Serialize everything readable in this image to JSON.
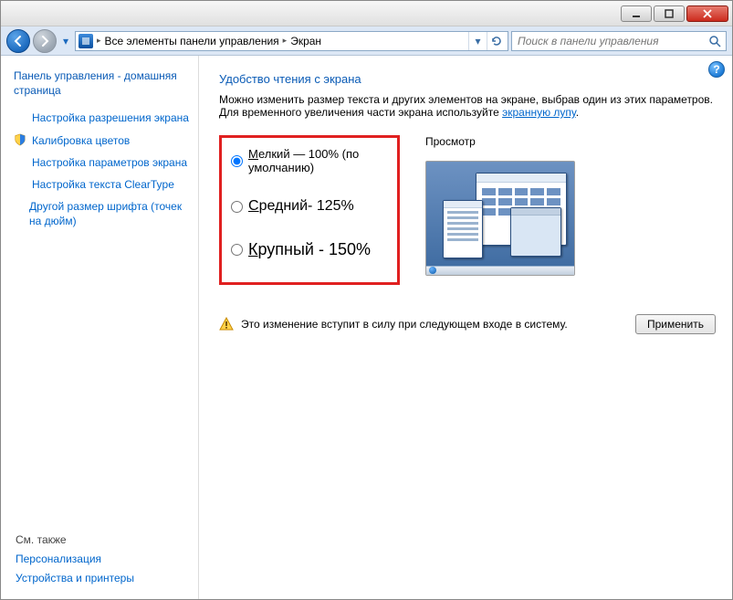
{
  "titlebar": {},
  "nav": {
    "breadcrumb": {
      "parent": "Все элементы панели управления",
      "current": "Экран"
    },
    "search_placeholder": "Поиск в панели управления"
  },
  "sidebar": {
    "home": "Панель управления - домашняя страница",
    "links": [
      {
        "label": "Настройка разрешения экрана"
      },
      {
        "label": "Калибровка цветов",
        "shield": true
      },
      {
        "label": "Настройка параметров экрана"
      },
      {
        "label": "Настройка текста ClearType"
      },
      {
        "label": "Другой размер шрифта (точек на дюйм)"
      }
    ],
    "see_also_label": "См. также",
    "see_also": [
      "Персонализация",
      "Устройства и принтеры"
    ]
  },
  "main": {
    "heading": "Удобство чтения с экрана",
    "desc_prefix": "Можно изменить размер текста и других элементов на экране, выбрав один из этих параметров. Для временного увеличения части экрана используйте ",
    "desc_link": "экранную лупу",
    "desc_suffix": ".",
    "options": {
      "small_prefix": "М",
      "small_rest": "елкий — 100% (по умолчанию)",
      "medium_prefix": "С",
      "medium_rest": "редний- 125%",
      "large_prefix": "К",
      "large_rest": "рупный - 150%",
      "selected": "small"
    },
    "preview_label": "Просмотр",
    "warning": "Это изменение вступит в силу при следующем входе в систему.",
    "apply_label": "Применить"
  }
}
